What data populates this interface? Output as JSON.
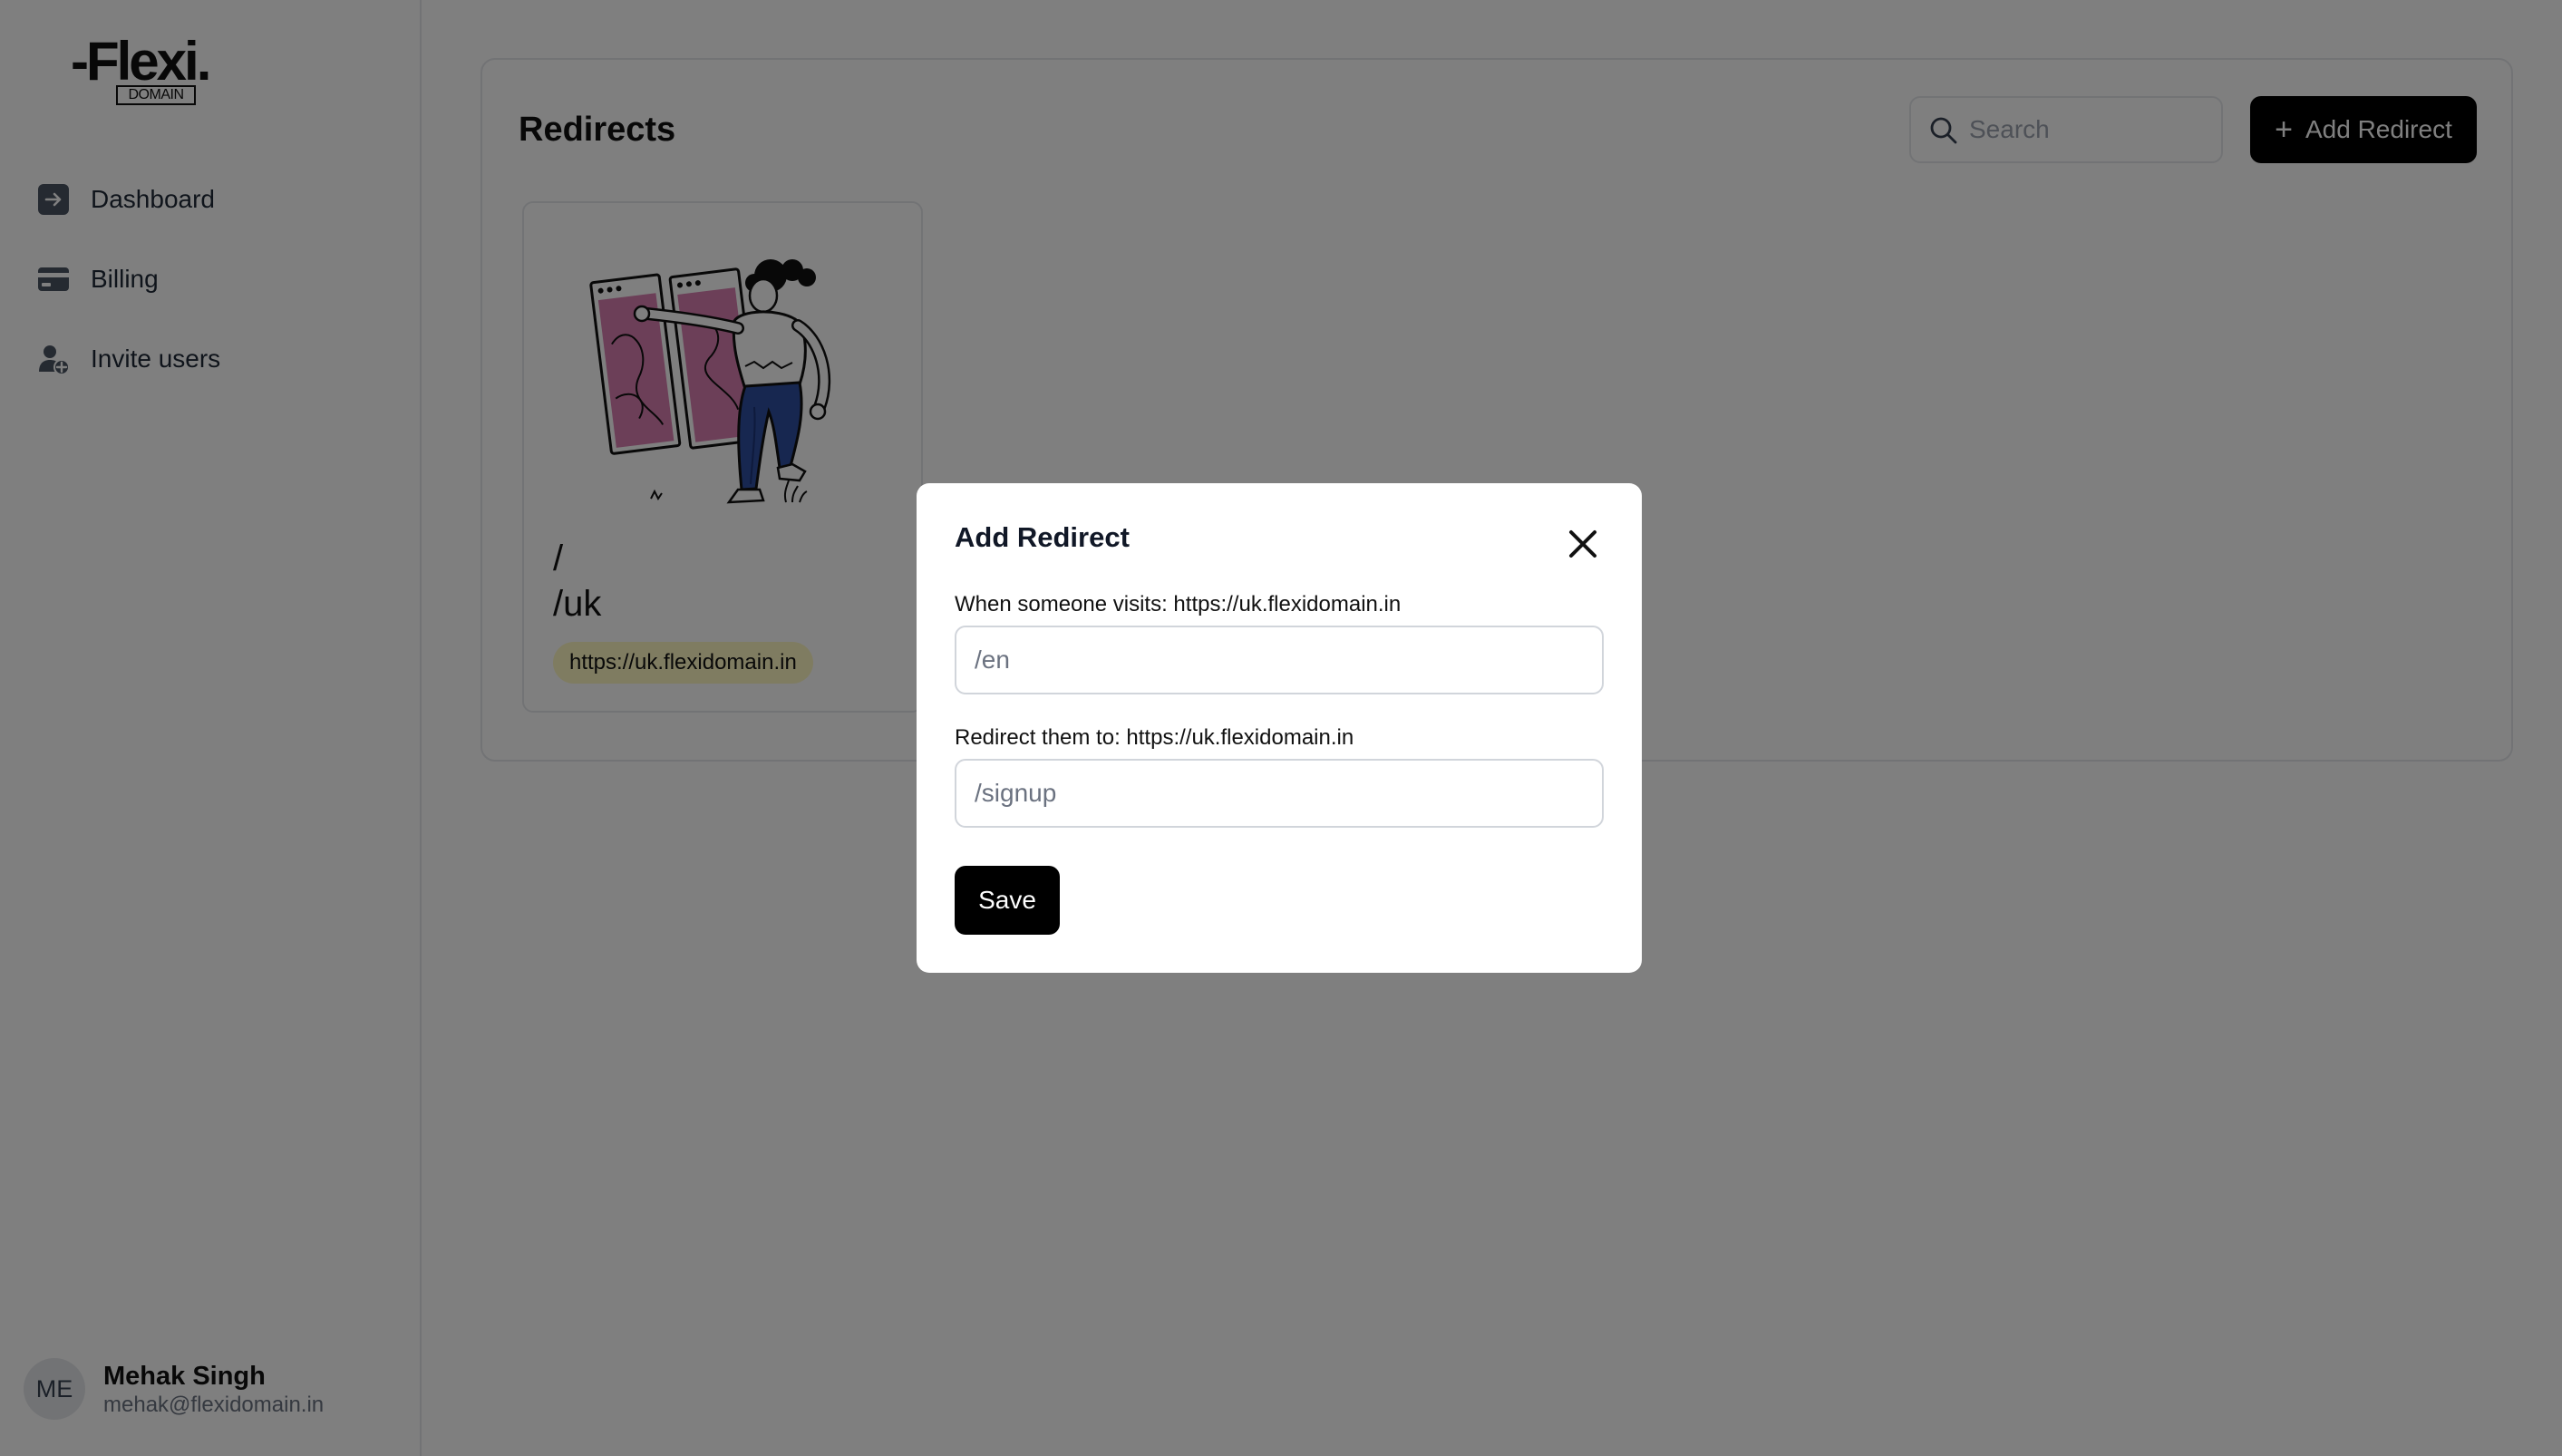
{
  "logo": {
    "word": "-Flexi.",
    "sub": "DOMAIN"
  },
  "sidebar": {
    "items": [
      {
        "label": "Dashboard",
        "icon": "arrow-right-box-icon"
      },
      {
        "label": "Billing",
        "icon": "credit-card-icon"
      },
      {
        "label": "Invite users",
        "icon": "user-plus-icon"
      }
    ]
  },
  "user": {
    "initials": "ME",
    "name": "Mehak Singh",
    "email": "mehak@flexidomain.in"
  },
  "main": {
    "title": "Redirects",
    "search": {
      "placeholder": "Search",
      "value": ""
    },
    "add_button": {
      "plus": "+",
      "label": "Add Redirect"
    },
    "cards": [
      {
        "from": "/",
        "to": "/uk",
        "badge": "https://uk.flexidomain.in"
      }
    ]
  },
  "modal": {
    "title": "Add Redirect",
    "close_icon": "close-icon",
    "visits_label": "When someone visits: https://uk.flexidomain.in",
    "visits_placeholder": "/en",
    "visits_value": "",
    "redirect_label": "Redirect them to: https://uk.flexidomain.in",
    "redirect_placeholder": "/signup",
    "redirect_value": "",
    "save_label": "Save"
  },
  "colors": {
    "primary": "#000000",
    "badge_bg": "#fef9c3",
    "overlay": "rgba(0,0,0,0.5)",
    "border": "#e5e7eb",
    "illustration_accent": "#d97fb0",
    "illustration_pants": "#2f4ea0"
  }
}
